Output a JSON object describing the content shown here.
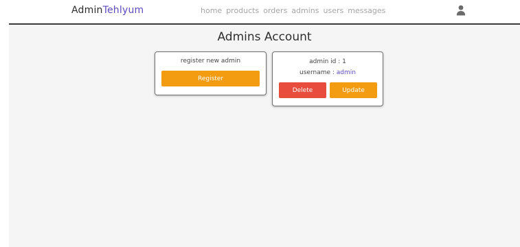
{
  "header": {
    "logo_main": "Admin",
    "logo_accent": "Tehlyum",
    "nav": [
      "home",
      "products",
      "orders",
      "admins",
      "users",
      "messages"
    ],
    "user_icon": "user-icon"
  },
  "main": {
    "title": "Admins Account",
    "register_card": {
      "label": "register new admin",
      "button": "Register"
    },
    "admin_card": {
      "id_label": "admin id : ",
      "id_value": "1",
      "username_label": "username : ",
      "username_value": "admin",
      "delete_button": "Delete",
      "update_button": "Update"
    }
  },
  "colors": {
    "accent": "#5d4bc2",
    "orange_button": "#f39c12",
    "red_button": "#e74c3c",
    "background": "#f5f5f5"
  }
}
